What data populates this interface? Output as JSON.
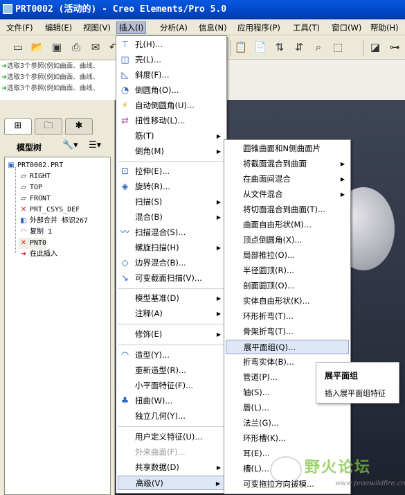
{
  "window": {
    "title": "PRT0002 (活动的) - Creo Elements/Pro 5.0"
  },
  "menubar": [
    {
      "label": "文件(F)",
      "active": false
    },
    {
      "label": "编辑(E)",
      "active": false
    },
    {
      "label": "视图(V)",
      "active": false
    },
    {
      "label": "插入(I)",
      "active": true
    },
    {
      "label": "分析(A)",
      "active": false
    },
    {
      "label": "信息(N)",
      "active": false
    },
    {
      "label": "应用程序(P)",
      "active": false
    },
    {
      "label": "工具(T)",
      "active": false
    },
    {
      "label": "窗口(W)",
      "active": false
    },
    {
      "label": "帮助(H)",
      "active": false
    }
  ],
  "messages": [
    "选取3个参照(例如曲面、曲线、",
    "选取3个参照(例如曲面、曲线、",
    "选取3个参照(例如曲面、曲线、"
  ],
  "model_tree": {
    "title": "模型树",
    "items": [
      {
        "label": "PRT0002.PRT",
        "icon": "part-icon"
      },
      {
        "label": "RIGHT",
        "icon": "datum-plane-icon"
      },
      {
        "label": "TOP",
        "icon": "datum-plane-icon"
      },
      {
        "label": "FRONT",
        "icon": "datum-plane-icon"
      },
      {
        "label": "PRT_CSYS_DEF",
        "icon": "csys-icon"
      },
      {
        "label": "外部合并 标识267",
        "icon": "merge-icon"
      },
      {
        "label": "复制 1",
        "icon": "copy-icon"
      },
      {
        "label": "PNT0",
        "icon": "datum-point-icon"
      },
      {
        "label": "在此插入",
        "icon": "insert-here-arrow-icon"
      }
    ]
  },
  "insert_menu": {
    "items": [
      {
        "label": "孔(H)...",
        "icon": "hole-icon",
        "submenu": false
      },
      {
        "label": "壳(L)...",
        "icon": "shell-icon",
        "submenu": false
      },
      {
        "label": "斜度(F)...",
        "icon": "draft-icon",
        "submenu": false
      },
      {
        "label": "倒圆角(O)...",
        "icon": "round-icon",
        "submenu": false
      },
      {
        "label": "自动倒圆角(U)...",
        "icon": "auto-round-icon",
        "submenu": false
      },
      {
        "label": "扭性移动(L)...",
        "icon": "flex-move-icon",
        "submenu": false
      },
      {
        "label": "筋(T)",
        "icon": "",
        "submenu": true
      },
      {
        "label": "倒角(M)",
        "icon": "",
        "submenu": true
      },
      {
        "label": "拉伸(E)...",
        "icon": "extrude-icon",
        "submenu": false
      },
      {
        "label": "旋转(R)...",
        "icon": "revolve-icon",
        "submenu": false
      },
      {
        "label": "扫描(S)",
        "icon": "",
        "submenu": true
      },
      {
        "label": "混合(B)",
        "icon": "",
        "submenu": true
      },
      {
        "label": "扫描混合(S)...",
        "icon": "swept-blend-icon",
        "submenu": false
      },
      {
        "label": "螺旋扫描(H)",
        "icon": "",
        "submenu": true
      },
      {
        "label": "边界混合(B)...",
        "icon": "boundary-blend-icon",
        "submenu": false
      },
      {
        "label": "可变截面扫描(V)...",
        "icon": "var-section-sweep-icon",
        "submenu": false
      },
      {
        "label": "模型基准(D)",
        "icon": "",
        "submenu": true
      },
      {
        "label": "注释(A)",
        "icon": "",
        "submenu": true
      },
      {
        "label": "修饰(E)",
        "icon": "",
        "submenu": true
      },
      {
        "label": "造型(Y)...",
        "icon": "style-icon",
        "submenu": false
      },
      {
        "label": "重新造型(R)...",
        "icon": "",
        "submenu": false
      },
      {
        "label": "小平面特征(F)...",
        "icon": "",
        "submenu": false
      },
      {
        "label": "扭曲(W)...",
        "icon": "warp-icon",
        "submenu": false
      },
      {
        "label": "独立几何(Y)...",
        "icon": "",
        "submenu": false
      },
      {
        "label": "用户定义特征(U)...",
        "icon": "",
        "submenu": false
      },
      {
        "label": "外来曲面(F)...",
        "icon": "",
        "submenu": false,
        "disabled": true
      },
      {
        "label": "共享数据(D)",
        "icon": "",
        "submenu": true
      },
      {
        "label": "高级(V)",
        "icon": "",
        "submenu": true,
        "highlighted": true
      }
    ]
  },
  "advanced_menu": {
    "items": [
      {
        "label": "圆锥曲面和N侧曲面片",
        "submenu": false
      },
      {
        "label": "将截面混合到曲面",
        "submenu": true
      },
      {
        "label": "在曲面间混合",
        "submenu": true
      },
      {
        "label": "从文件混合",
        "submenu": true
      },
      {
        "label": "将切面混合到曲面(T)...",
        "submenu": false
      },
      {
        "label": "曲面自由形状(M)...",
        "submenu": false
      },
      {
        "label": "顶点倒圆角(X)...",
        "submenu": false
      },
      {
        "label": "局部推拉(O)...",
        "submenu": false
      },
      {
        "label": "半径圆顶(R)...",
        "submenu": false
      },
      {
        "label": "剖面圆顶(O)...",
        "submenu": false
      },
      {
        "label": "实体自由形状(K)...",
        "submenu": false
      },
      {
        "label": "环形折弯(T)...",
        "submenu": false
      },
      {
        "label": "骨架折弯(T)...",
        "submenu": false
      },
      {
        "label": "展平面组(Q)...",
        "submenu": false,
        "highlighted": true
      },
      {
        "label": "折弯实体(B)...",
        "submenu": false
      },
      {
        "label": "管道(P)...",
        "submenu": false
      },
      {
        "label": "轴(S)...",
        "submenu": false
      },
      {
        "label": "唇(L)...",
        "submenu": false
      },
      {
        "label": "法兰(G)...",
        "submenu": false
      },
      {
        "label": "环形槽(K)...",
        "submenu": false
      },
      {
        "label": "耳(E)...",
        "submenu": false
      },
      {
        "label": "槽(L)...",
        "submenu": false
      },
      {
        "label": "可变拖拉方向拔模...",
        "submenu": false
      }
    ]
  },
  "tooltip": {
    "title": "展平面组",
    "description": "插入展平面组特征"
  },
  "watermark": {
    "text": "野火论坛",
    "url": "www.proewildfire.cn"
  }
}
